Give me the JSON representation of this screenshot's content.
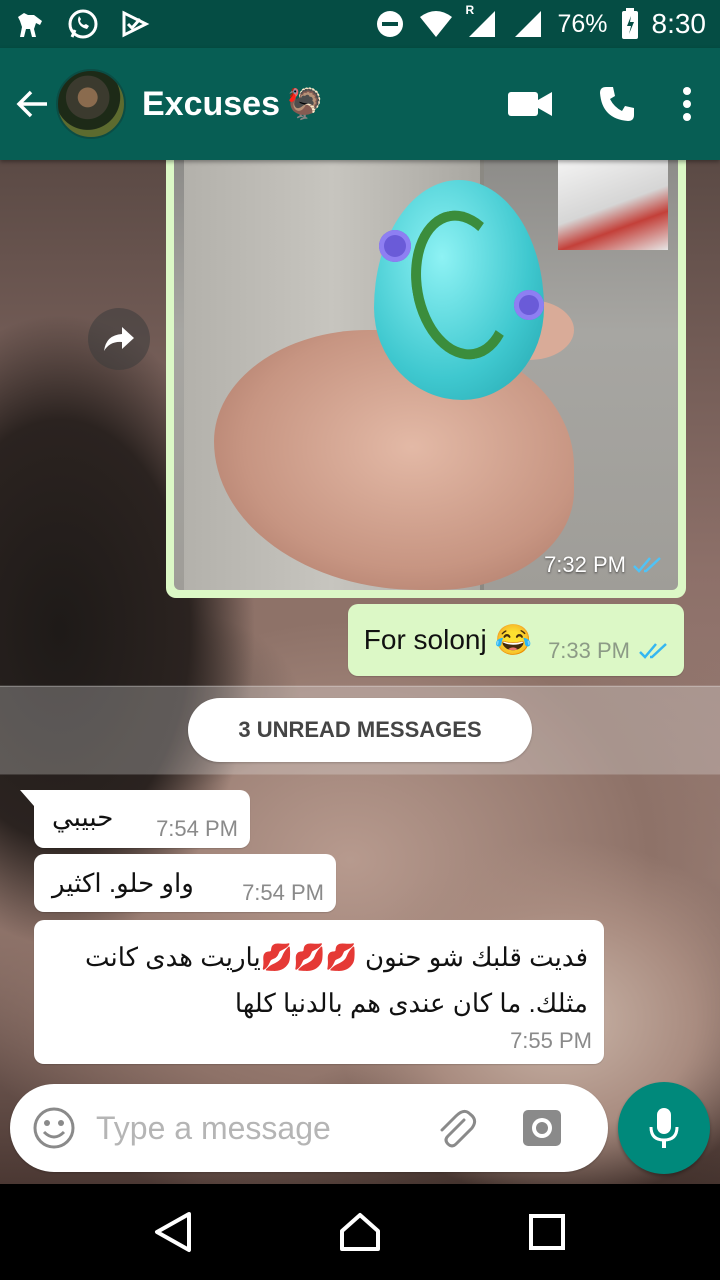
{
  "status_bar": {
    "battery_percent": "76%",
    "time": "8:30",
    "signal_label": "R",
    "icons": [
      "dog-app-icon",
      "whatsapp-icon",
      "download-check-icon",
      "do-not-disturb-icon",
      "wifi-icon",
      "signal-icon",
      "signal-icon",
      "battery-icon"
    ]
  },
  "app_bar": {
    "title": "Excuses",
    "title_emoji": "🦃",
    "icons": [
      "back-arrow-icon",
      "video-call-icon",
      "phone-call-icon",
      "more-vert-icon"
    ],
    "color": "#075e54"
  },
  "messages": {
    "image": {
      "time": "7:32 PM",
      "status_color": "#4fc3f7"
    },
    "outgoing_text": {
      "text": "For solonj",
      "emoji": "😂",
      "time": "7:33 PM"
    },
    "unread_label": "3 UNREAD MESSAGES",
    "incoming": [
      {
        "text": "حبيبي",
        "time": "7:54 PM"
      },
      {
        "text": "واو حلو. اكثير",
        "time": "7:54 PM"
      },
      {
        "text": "فديت قلبك شو حنون 💋💋💋ياريت هدى كانت مثلك. ما كان عندى هم بالدنيا كلها",
        "time": "7:55 PM"
      }
    ]
  },
  "composer": {
    "placeholder": "Type a message",
    "mic_color": "#00897b"
  },
  "colors": {
    "outgoing_bubble": "#dcf8c6",
    "incoming_bubble": "#ffffff",
    "status_bar": "#054d44"
  }
}
